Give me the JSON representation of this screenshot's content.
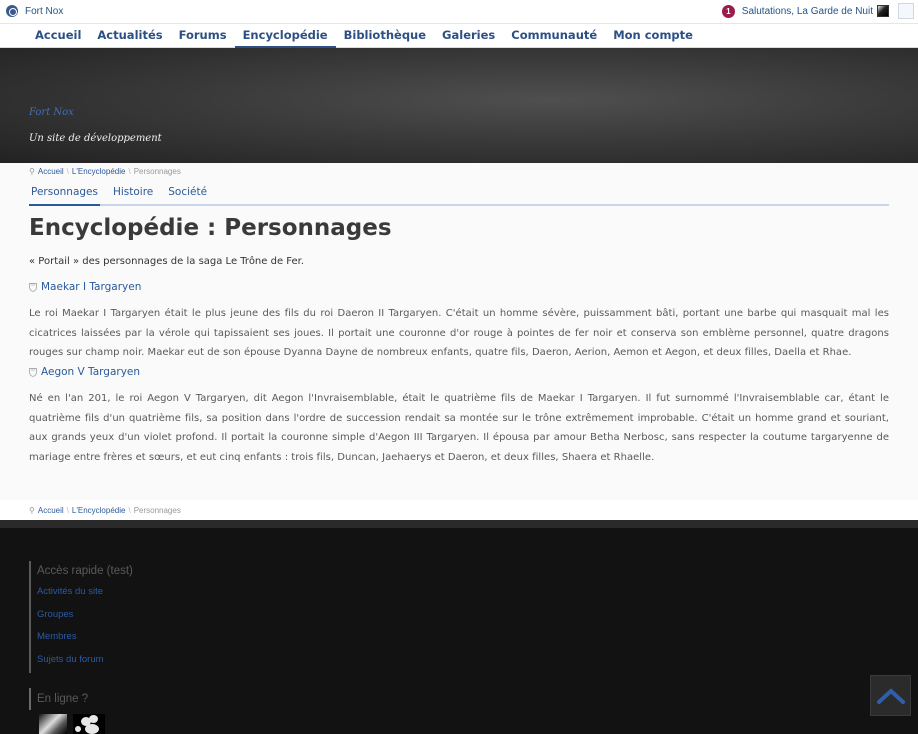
{
  "adminbar": {
    "site_name": "Fort Nox",
    "notification_count": "1",
    "greeting": "Salutations, La Garde de Nuit"
  },
  "nav": {
    "items": [
      "Accueil",
      "Actualités",
      "Forums",
      "Encyclopédie",
      "Bibliothèque",
      "Galeries",
      "Communauté",
      "Mon compte"
    ],
    "active": "Encyclopédie"
  },
  "hero": {
    "site_title": "Fort Nox",
    "tagline": "Un site de développement"
  },
  "breadcrumb": {
    "home": "Accueil",
    "section": "L'Encyclopédie",
    "current": "Personnages",
    "separator": "\\"
  },
  "tabs": {
    "items": [
      "Personnages",
      "Histoire",
      "Société"
    ],
    "active": "Personnages"
  },
  "page": {
    "title": "Encyclopédie : Personnages",
    "intro": "« Portail » des personnages de la saga Le Trône de Fer."
  },
  "entries": [
    {
      "name": "Maekar I Targaryen",
      "text": "Le roi Maekar I Targaryen était le plus jeune des fils du roi Daeron II Targaryen. C'était un homme sévère, puissamment bâti, portant une barbe qui masquait mal les cicatrices laissées par la vérole qui tapissaient ses joues. Il portait une couronne d'or rouge à pointes de fer noir et conserva son emblème personnel, quatre dragons rouges sur champ noir. Maekar eut de son épouse Dyanna Dayne de nombreux enfants, quatre fils, Daeron, Aerion, Aemon et Aegon, et deux filles, Daella et Rhae."
    },
    {
      "name": "Aegon V Targaryen",
      "text": "Né en l'an 201, le roi Aegon V Targaryen, dit Aegon l'Invraisemblable, était le quatrième fils de Maekar I Targaryen. Il fut surnommé l'Invraisemblable car, étant le quatrième fils d'un quatrième fils, sa position dans l'ordre de succession rendait sa montée sur le trône extrêmement improbable. C'était un homme grand et souriant, aux grands yeux d'un violet profond. Il portait la couronne simple d'Aegon III Targaryen. Il épousa par amour Betha Nerbosc, sans respecter la coutume targaryenne de mariage entre frères et sœurs, et eut cinq enfants : trois fils, Duncan, Jaehaerys et Daeron, et deux filles, Shaera et Rhaelle."
    }
  ],
  "footer": {
    "quick_title": "Accès rapide (test)",
    "quick_links": [
      "Activités du site",
      "Groupes",
      "Membres",
      "Sujets du forum"
    ],
    "online_title": "En ligne ?"
  },
  "colors": {
    "link": "#2a5a9a",
    "nav_text": "#2c4f86",
    "badge": "#9b1c4b",
    "footer_bg": "#121212"
  },
  "icons": {
    "site": "wordpress-globe-icon",
    "breadcrumb": "map-pin-icon",
    "entry": "shield-icon",
    "back_to_top": "chevron-up-icon"
  }
}
